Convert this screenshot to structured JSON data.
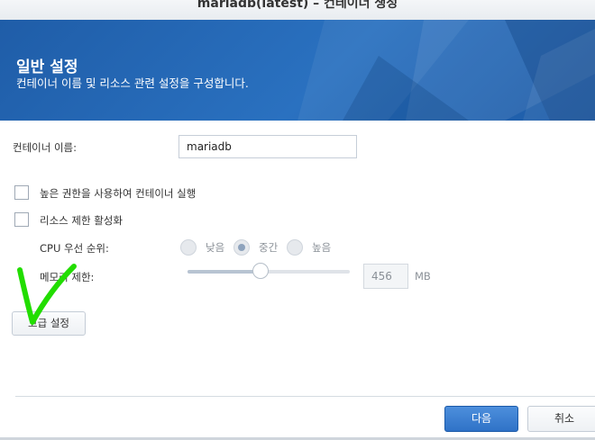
{
  "window": {
    "title": "mariadb(latest) – 컨테이너 생성"
  },
  "banner": {
    "title": "일반 설정",
    "subtitle": "컨테이너 이름 및 리소스 관련 설정을 구성합니다."
  },
  "form": {
    "container_name_label": "컨테이너 이름:",
    "container_name_value": "mariadb",
    "privileged_label": "높은 권한을 사용하여 컨테이너 실행",
    "privileged_checked": false,
    "resource_limit_label": "리소스 제한 활성화",
    "resource_limit_checked": false,
    "cpu_priority_label": "CPU 우선 순위:",
    "cpu_options": [
      "낮음",
      "중간",
      "높음"
    ],
    "cpu_selected": "중간",
    "memory_limit_label": "메모리 제한:",
    "memory_value": "456",
    "memory_unit": "MB",
    "memory_slider_fraction": 0.45
  },
  "buttons": {
    "advanced": "고급 설정",
    "next": "다음",
    "cancel": "취소"
  },
  "colors": {
    "banner": "#2a6bbd",
    "primary_button": "#3a7dd0",
    "annotation_mark": "#22dd00"
  }
}
